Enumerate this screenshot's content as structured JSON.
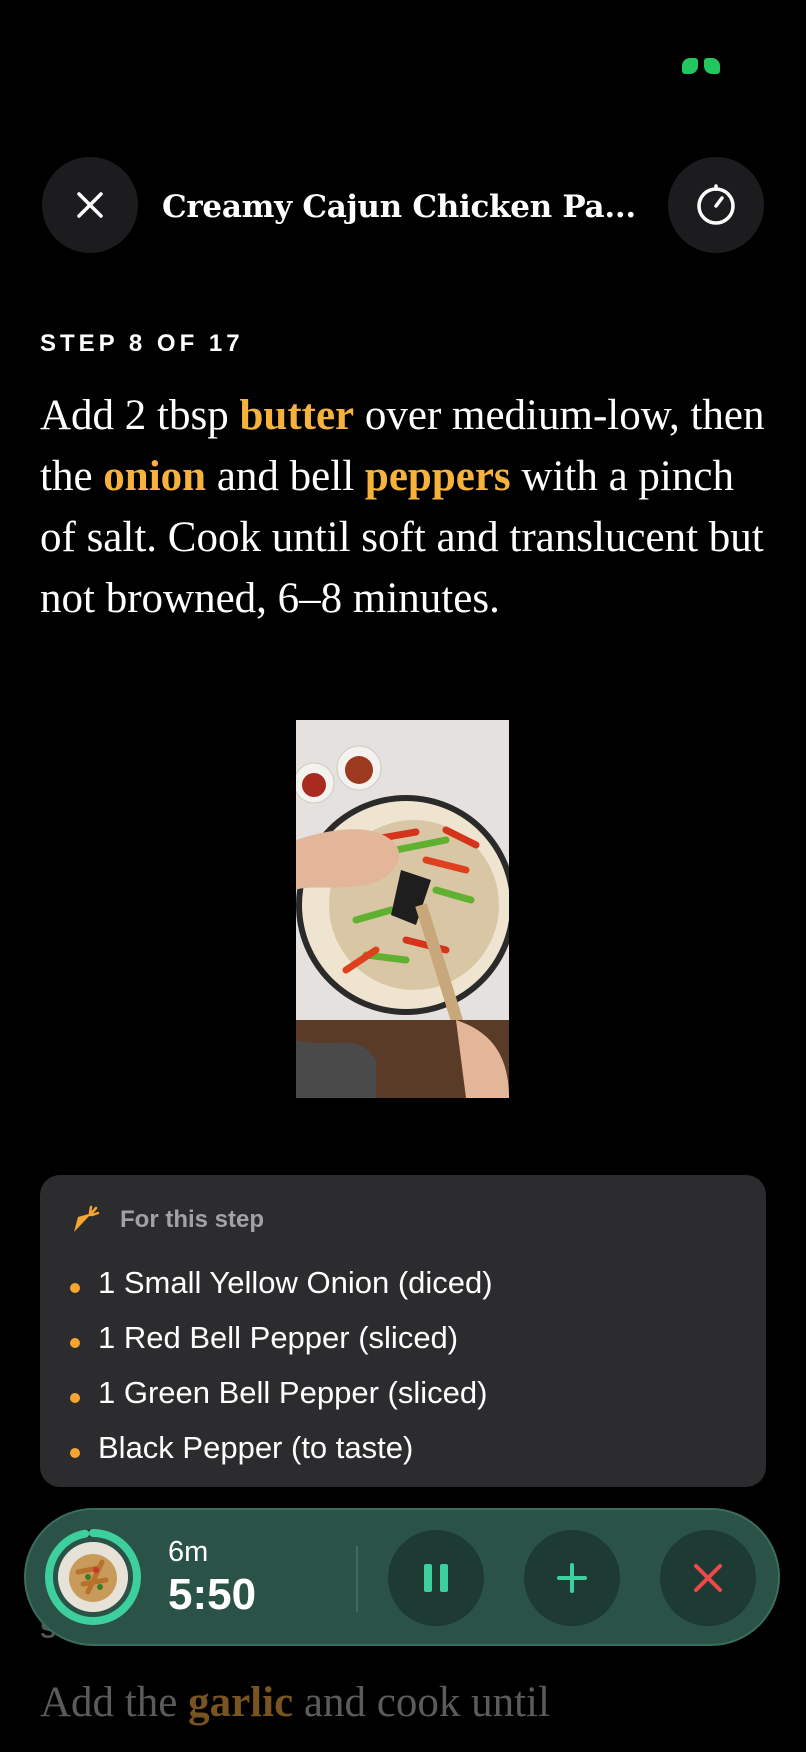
{
  "header": {
    "title": "Creamy Cajun Chicken Pa...",
    "close_icon": "close-icon",
    "timer_icon": "timer-icon"
  },
  "step": {
    "label": "STEP 8 OF 17",
    "instruction": {
      "p1": "Add 2 tbsp ",
      "h1": "butter",
      "p2": " over medium-low, then the ",
      "h2": "onion",
      "p3": " and bell ",
      "h3": "peppers",
      "p4": " with a pinch of salt. Cook until soft and translucent but not browned, 6–8 minutes."
    }
  },
  "ingredients": {
    "header_icon": "carrot-icon",
    "label": "For this step",
    "items": [
      "1 Small Yellow Onion (diced)",
      "1 Red Bell Pepper (sliced)",
      "1 Green Bell Pepper (sliced)",
      "Black Pepper (to taste)"
    ]
  },
  "next_step": {
    "label": "S",
    "p1": "Add the ",
    "h1": "garlic",
    "p2": " and cook until"
  },
  "timer": {
    "total": "6m",
    "remaining": "5:50",
    "progress": 0.97
  },
  "colors": {
    "highlight": "#f7b23b",
    "timer_bg": "#2a5246",
    "accent_green": "#3ecf9e",
    "stop_red": "#f0484a"
  }
}
